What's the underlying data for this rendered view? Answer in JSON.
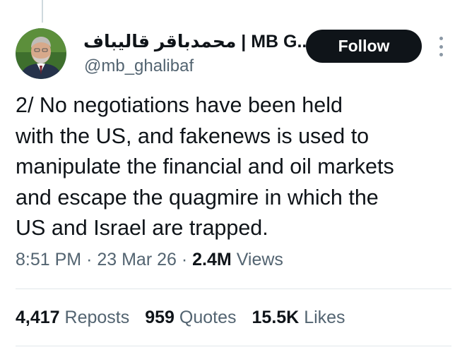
{
  "tweet": {
    "thread_label": "2/",
    "text": "2/ No negotiations have been held with the US, and fakenews is used to manipulate the financial and oil markets and escape the quagmire in which the US and Israel are trapped.",
    "text_lines": [
      "2/ No negotiations have been held",
      "with the US, and fakenews is used to",
      "manipulate the financial and oil markets",
      "and escape the quagmire in which the",
      "US and Israel are trapped."
    ]
  },
  "author": {
    "display_name": "محمدباقر قالیباف | MB G...",
    "handle": "@mb_ghalibaf",
    "avatar_icon": "user-avatar-photo"
  },
  "actions": {
    "follow_label": "Follow",
    "more_icon": "more-vertical-icon"
  },
  "meta": {
    "time": "8:51 PM",
    "date": "23 Mar 26",
    "views_count": "2.4M",
    "views_label": "Views",
    "separator": "·"
  },
  "stats": {
    "reposts_count": "4,417",
    "reposts_label": "Reposts",
    "quotes_count": "959",
    "quotes_label": "Quotes",
    "likes_count": "15.5K",
    "likes_label": "Likes"
  },
  "colors": {
    "text_primary": "#0f1419",
    "text_secondary": "#536471",
    "button_bg": "#0f1419",
    "divider": "#e1e7ea"
  }
}
